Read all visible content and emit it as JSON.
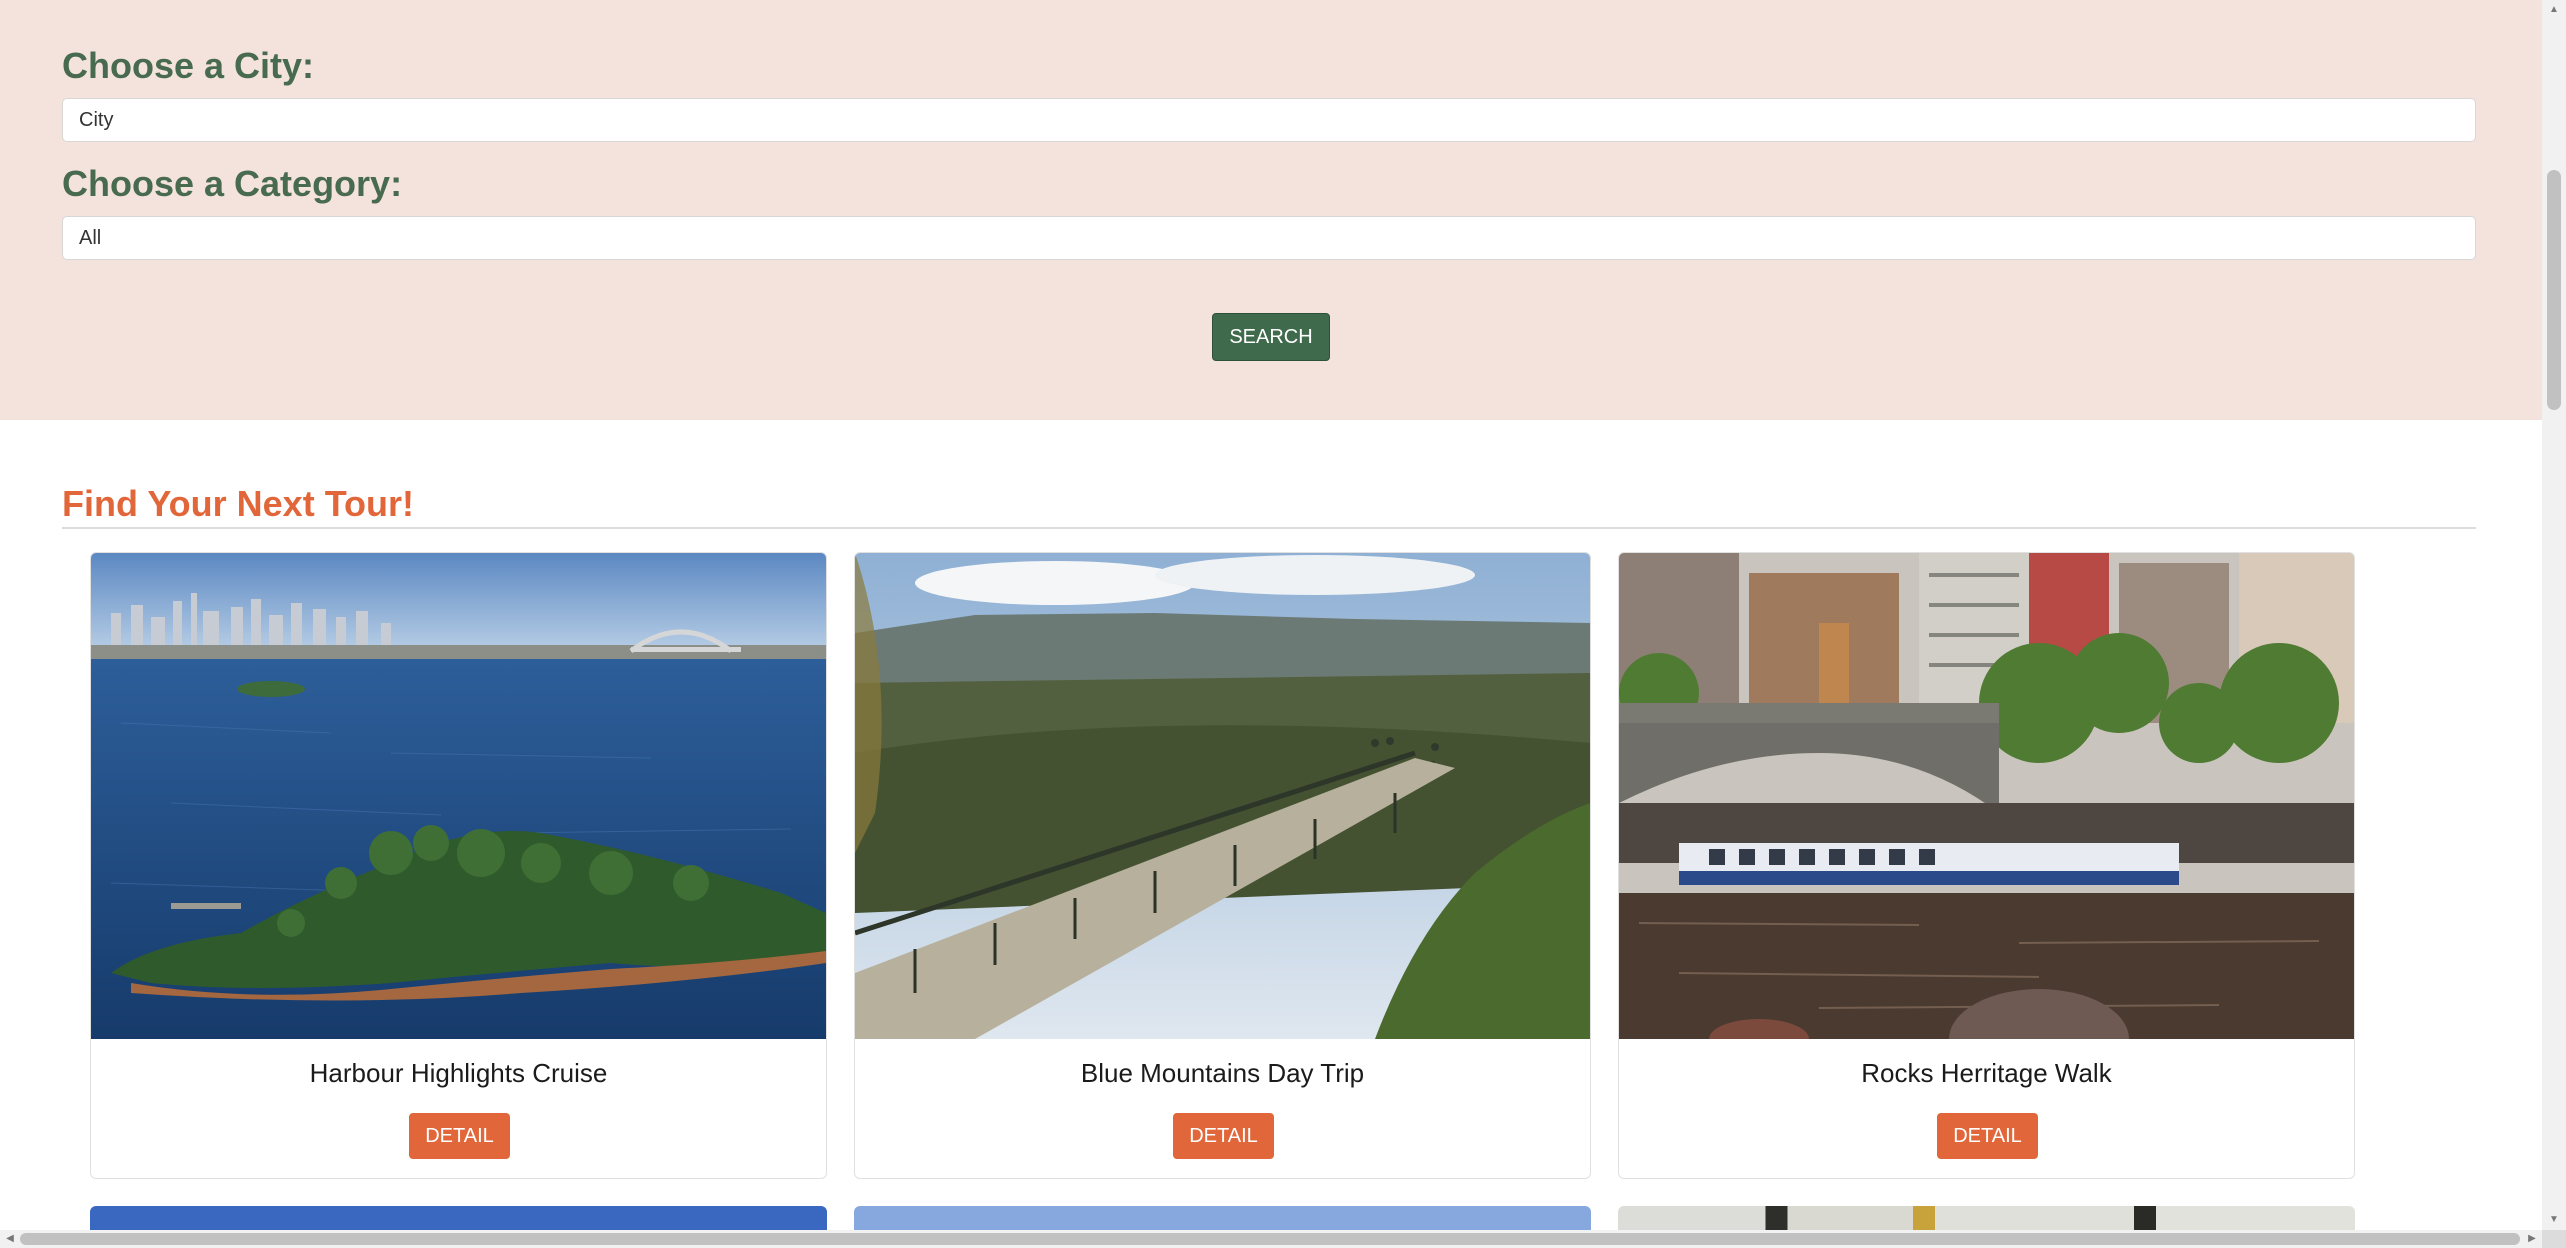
{
  "search_panel": {
    "city_label": "Choose a City:",
    "city_value": "City",
    "category_label": "Choose a Category:",
    "category_value": "All",
    "search_label": "SEARCH"
  },
  "tours_section": {
    "title": "Find Your Next Tour!",
    "cards": [
      {
        "title": "Harbour Highlights Cruise",
        "detail_label": "DETAIL",
        "image": "harbour-photo"
      },
      {
        "title": "Blue Mountains Day Trip",
        "detail_label": "DETAIL",
        "image": "mountains-photo"
      },
      {
        "title": "Rocks Herritage Walk",
        "detail_label": "DETAIL",
        "image": "river-city-photo"
      }
    ]
  },
  "colors": {
    "panel_bg": "#f4e2dc",
    "label_green": "#486a4f",
    "search_button": "#3f6a4c",
    "accent_orange": "#e1673a"
  }
}
